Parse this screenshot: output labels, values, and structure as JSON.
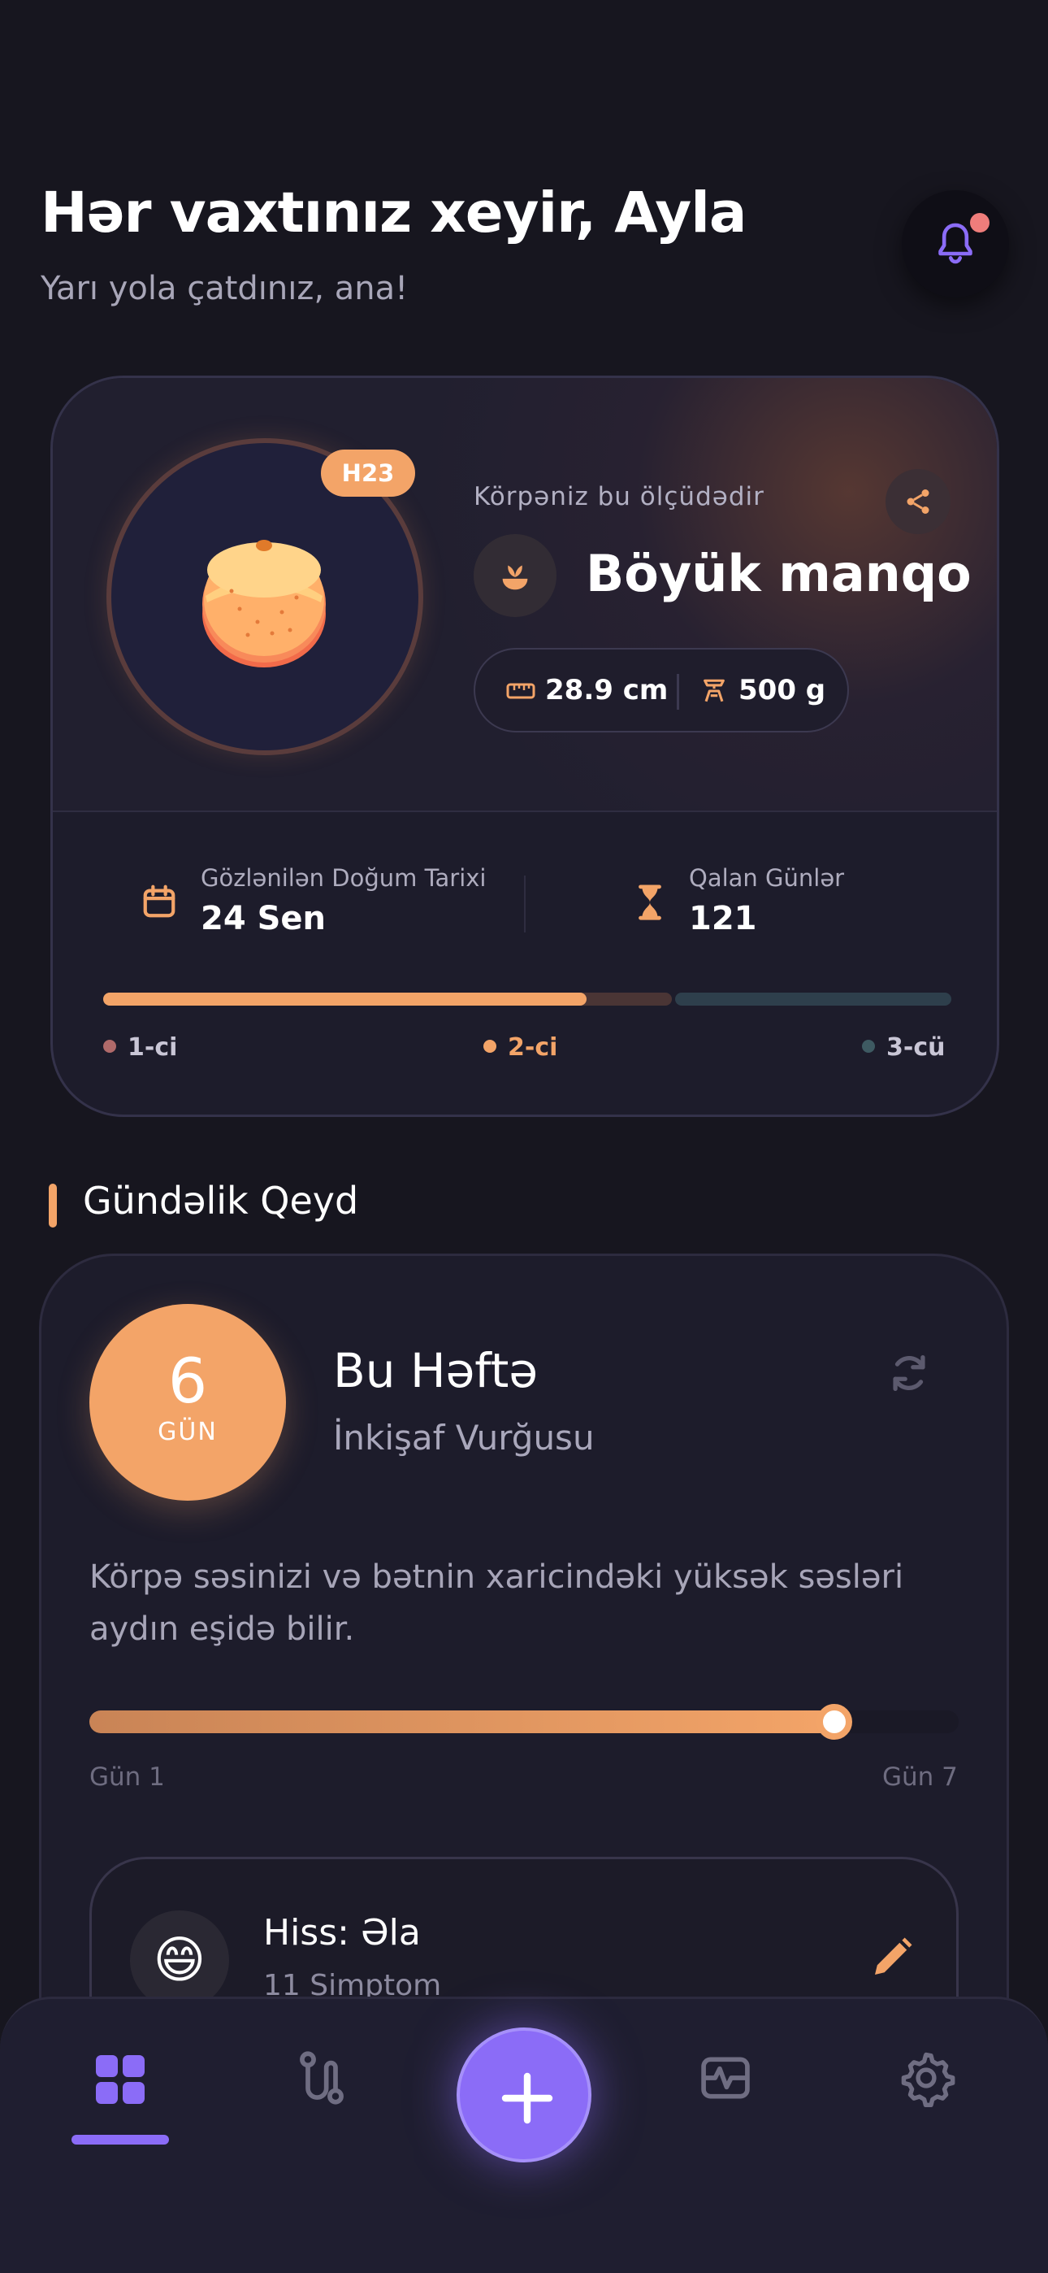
{
  "header": {
    "greeting": "Hər vaxtınız xeyir, Ayla",
    "subtitle": "Yarı yola çatdınız, ana!"
  },
  "hero": {
    "week_badge": "H23",
    "size_label": "Körpəniz bu ölçüdədir",
    "fruit_name": "Böyük manqo",
    "length": "28.9 cm",
    "weight": "500 g",
    "due_label": "Gözlənilən Doğum Tarixi",
    "due_value": "24 Sen",
    "remaining_label": "Qalan Günlər",
    "remaining_value": "121",
    "trimester_progress": 0.57,
    "trimesters": [
      {
        "label": "1-ci",
        "color": "#b06a6a"
      },
      {
        "label": "2-ci",
        "color": "#f3a468"
      },
      {
        "label": "3-cü",
        "color": "#3e5a62"
      }
    ]
  },
  "daily": {
    "section_title": "Gündəlik Qeyd",
    "day_number": "6",
    "day_unit": "GÜN",
    "week_title": "Bu Həftə",
    "focus_label": "İnkişaf Vurğusu",
    "description": "Körpə səsinizi və bətnin xaricindəki yüksək səsləri aydın eşidə bilir.",
    "progress": 0.857,
    "start_label": "Gün 1",
    "end_label": "Gün 7",
    "entry": {
      "emoji": "😄",
      "feeling": "Hiss: Əla",
      "symptoms": "11 Simptom"
    }
  },
  "colors": {
    "accent_orange": "#f3a468",
    "accent_purple": "#8b6cf7",
    "background": "#17161f",
    "notification_dot": "#ef7d7b"
  },
  "nav": {
    "items": [
      "dashboard-icon",
      "timeline-icon",
      "add-icon",
      "health-monitor-icon",
      "settings-icon"
    ],
    "active": "dashboard-icon"
  }
}
